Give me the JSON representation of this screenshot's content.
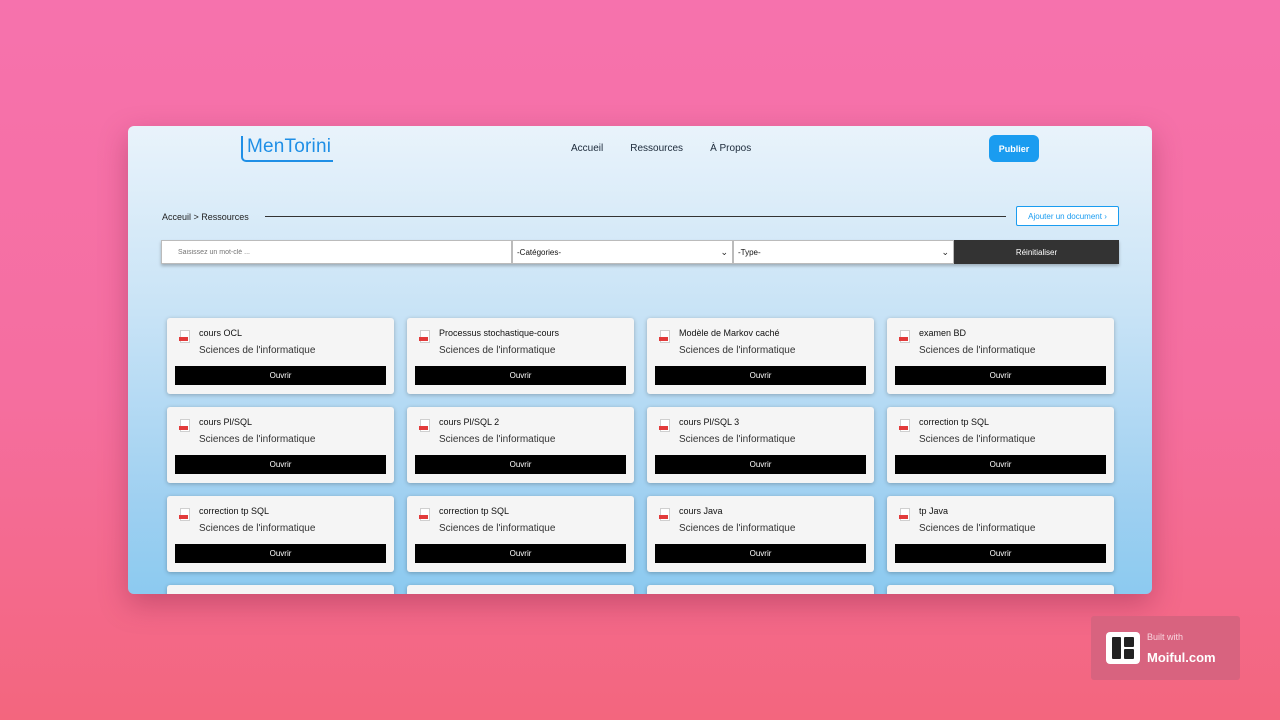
{
  "app": {
    "logo": "MenTorini"
  },
  "nav": {
    "items": [
      "Accueil",
      "Ressources",
      "À Propos"
    ],
    "publish_label": "Publier"
  },
  "breadcrumb": {
    "text": "Acceuil > Ressources"
  },
  "actions": {
    "add_document_label": "Ajouter un document ›"
  },
  "filters": {
    "search_placeholder": "Saisissez un mot-clé ...",
    "category_value": "-Catégories-",
    "type_value": "-Type-",
    "reset_label": "Réinitialiser"
  },
  "documents": [
    {
      "title": "cours OCL",
      "category": "Sciences de l'informatique"
    },
    {
      "title": "Processus stochastique-cours",
      "category": "Sciences de l'informatique"
    },
    {
      "title": "Modèle de Markov caché",
      "category": "Sciences de l'informatique"
    },
    {
      "title": "examen BD",
      "category": "Sciences de l'informatique"
    },
    {
      "title": "cours Pl/SQL",
      "category": "Sciences de l'informatique"
    },
    {
      "title": "cours Pl/SQL 2",
      "category": "Sciences de l'informatique"
    },
    {
      "title": "cours Pl/SQL 3",
      "category": "Sciences de l'informatique"
    },
    {
      "title": "correction tp SQL",
      "category": "Sciences de l'informatique"
    },
    {
      "title": "correction tp SQL",
      "category": "Sciences de l'informatique"
    },
    {
      "title": "correction tp SQL",
      "category": "Sciences de l'informatique"
    },
    {
      "title": "cours Java",
      "category": "Sciences de l'informatique"
    },
    {
      "title": "tp Java",
      "category": "Sciences de l'informatique"
    },
    {
      "title": "",
      "category": ""
    },
    {
      "title": "",
      "category": ""
    },
    {
      "title": "",
      "category": ""
    },
    {
      "title": "",
      "category": ""
    }
  ],
  "open_label": "Ouvrir",
  "badge": {
    "top": "Built with",
    "main": "Moiful.com"
  }
}
